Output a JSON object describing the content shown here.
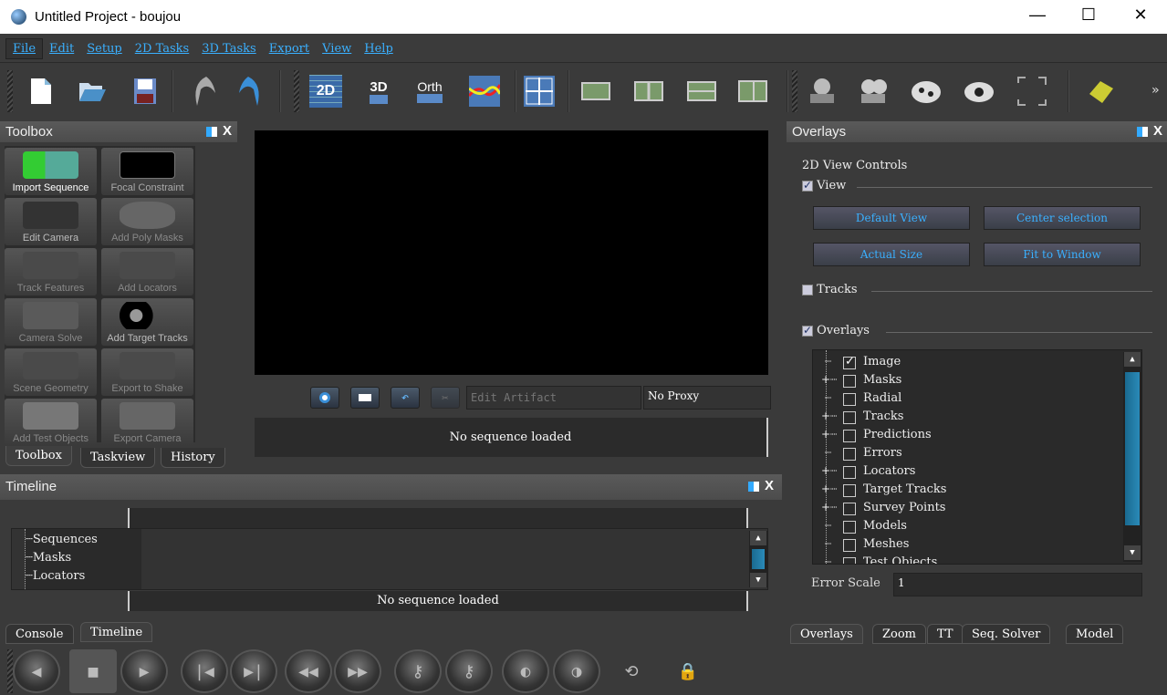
{
  "window": {
    "title": "Untitled Project - boujou",
    "minimize": "—",
    "maximize": "☐",
    "close": "✕"
  },
  "menu": [
    "File",
    "Edit",
    "Setup",
    "2D Tasks",
    "3D Tasks",
    "Export",
    "View",
    "Help"
  ],
  "toolbar": {
    "icons": [
      "new-file-icon",
      "open-folder-icon",
      "save-icon",
      "undo-icon",
      "redo-icon",
      "2d-view-icon",
      "3d-view-icon",
      "ortho-view-icon",
      "graph-view-icon",
      "quad-view-icon",
      "single-image-icon",
      "dual-image-icon",
      "film-strip-icon",
      "multi-view-icon",
      "camera-solve-icon",
      "camera-export-icon",
      "film-camera-icon",
      "eye-camera-icon",
      "frame-select-icon",
      "puzzle-icon"
    ],
    "labels": {
      "2d": "2D",
      "3d": "3D",
      "orth": "Orth"
    },
    "more": "»"
  },
  "toolbox": {
    "title": "Toolbox",
    "close": "X",
    "tools": [
      "Import Sequence",
      "Focal Constraint",
      "Edit Camera",
      "Add Poly Masks",
      "Track Features",
      "Add Locators",
      "Camera Solve",
      "Add Target Tracks",
      "Scene Geometry",
      "Export to Shake",
      "Add Test Objects",
      "Export Camera"
    ],
    "tabs": [
      "Toolbox",
      "Taskview",
      "History"
    ]
  },
  "viewer": {
    "artifact_placeholder": "Edit Artifact",
    "proxy": "No Proxy",
    "status": "No sequence loaded"
  },
  "timeline": {
    "title": "Timeline",
    "close": "X",
    "items": [
      "Sequences",
      "Masks",
      "Locators"
    ],
    "status": "No sequence loaded",
    "tabs": [
      "Console",
      "Timeline"
    ]
  },
  "overlays": {
    "title": "Overlays",
    "close": "X",
    "heading": "2D View Controls",
    "view": {
      "label": "View",
      "checked": true
    },
    "buttons": [
      "Default View",
      "Center selection",
      "Actual Size",
      "Fit to Window"
    ],
    "tracks": {
      "label": "Tracks",
      "checked": false
    },
    "overlays_section": {
      "label": "Overlays",
      "checked": true
    },
    "tree": [
      {
        "label": "Image",
        "checked": true,
        "expandable": false
      },
      {
        "label": "Masks",
        "checked": false,
        "expandable": true
      },
      {
        "label": "Radial",
        "checked": false,
        "expandable": false
      },
      {
        "label": "Tracks",
        "checked": false,
        "expandable": true
      },
      {
        "label": "Predictions",
        "checked": false,
        "expandable": true
      },
      {
        "label": "Errors",
        "checked": false,
        "expandable": false
      },
      {
        "label": "Locators",
        "checked": false,
        "expandable": true
      },
      {
        "label": "Target Tracks",
        "checked": false,
        "expandable": true
      },
      {
        "label": "Survey Points",
        "checked": false,
        "expandable": true
      },
      {
        "label": "Models",
        "checked": false,
        "expandable": false
      },
      {
        "label": "Meshes",
        "checked": false,
        "expandable": false
      },
      {
        "label": "Test Objects",
        "checked": false,
        "expandable": false
      }
    ],
    "error_scale_label": "Error Scale",
    "error_scale": "1",
    "tabs": [
      "Overlays",
      "Zoom",
      "TT",
      "Seq. Solver",
      "Model"
    ]
  },
  "transport": [
    "prev-frame-icon",
    "stop-icon",
    "play-icon",
    "step-back-icon",
    "step-forward-icon",
    "rewind-icon",
    "fast-forward-icon",
    "key-prev-icon",
    "key-next-icon",
    "mark-in-icon",
    "mark-out-icon",
    "loop-icon",
    "lock-icon"
  ],
  "colors": {
    "accent": "#3ab0ff",
    "bg": "#3a3a3a"
  }
}
